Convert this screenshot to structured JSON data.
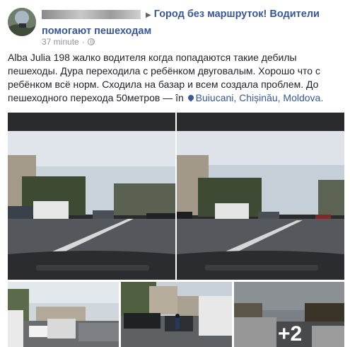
{
  "post": {
    "author_name": "",
    "separator_icon": "triangle-right",
    "group_name": "Город без маршруток! Водители помогают пешеходам",
    "timestamp": "37 minute",
    "text": "Alba Julia 198 жалко водителя когда попадаются такие дебилы пешеходы. Дура переходила с ребёнком двуговалым. Хорошо что с ребёнком всё норм. Сходила на базар и всем создала проблем. До пешеходного перехода 50метров",
    "location_prefix": " — în ",
    "location_parts": [
      "Buiucani",
      "Chișinău",
      "Moldova"
    ],
    "location_separator": ", ",
    "location_end": ".",
    "more_photos_label": "+2"
  },
  "colors": {
    "link": "#385898",
    "meta": "#90949c",
    "text": "#1d2129"
  }
}
